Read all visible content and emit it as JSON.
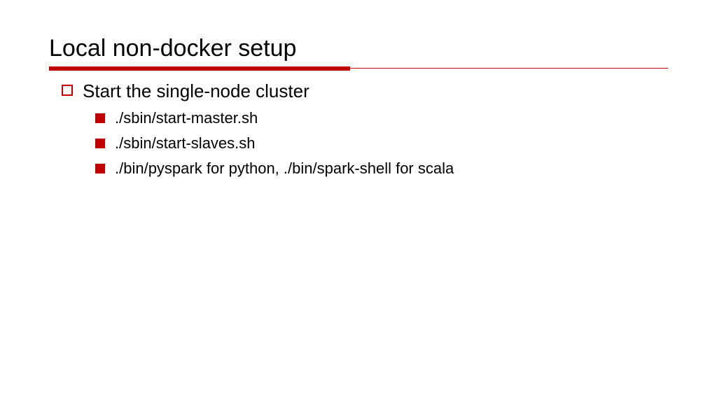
{
  "title": "Local non-docker setup",
  "colors": {
    "accent": "#c00000"
  },
  "outline": {
    "item_label": "Start the single-node cluster",
    "sub_items": [
      "./sbin/start-master.sh",
      "./sbin/start-slaves.sh",
      "./bin/pyspark for python, ./bin/spark-shell for scala"
    ]
  }
}
